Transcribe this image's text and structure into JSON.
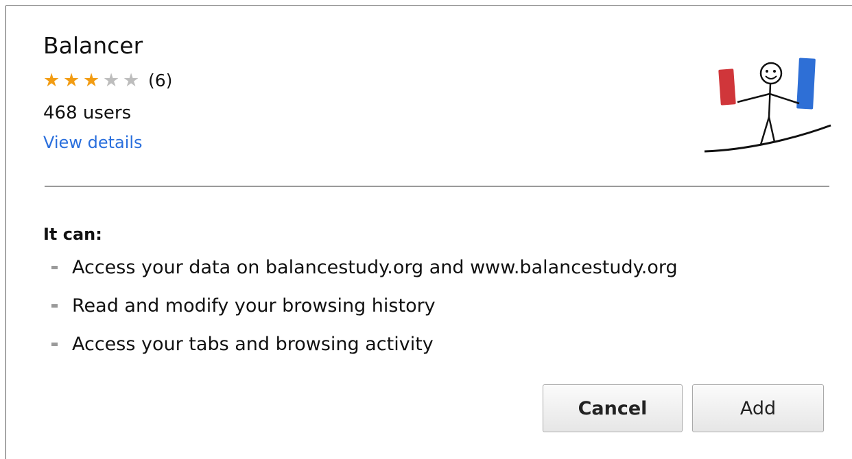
{
  "extension": {
    "name": "Balancer",
    "rating": {
      "value": 3,
      "max": 5,
      "count_label": "(6)"
    },
    "users_label": "468 users",
    "details_link": "View details",
    "logo_icon": "stick-figure-balancing-icon"
  },
  "permissions": {
    "heading": "It can:",
    "items": [
      "Access your data on balancestudy.org and www.balancestudy.org",
      "Read and modify your browsing history",
      "Access your tabs and browsing activity"
    ]
  },
  "buttons": {
    "cancel_label": "Cancel",
    "add_label": "Add"
  },
  "colors": {
    "star_filled": "#f29c12",
    "star_empty": "#bdbdbd",
    "link": "#2a6fdd",
    "logo_red": "#d0363a",
    "logo_blue": "#2e6fd6"
  }
}
